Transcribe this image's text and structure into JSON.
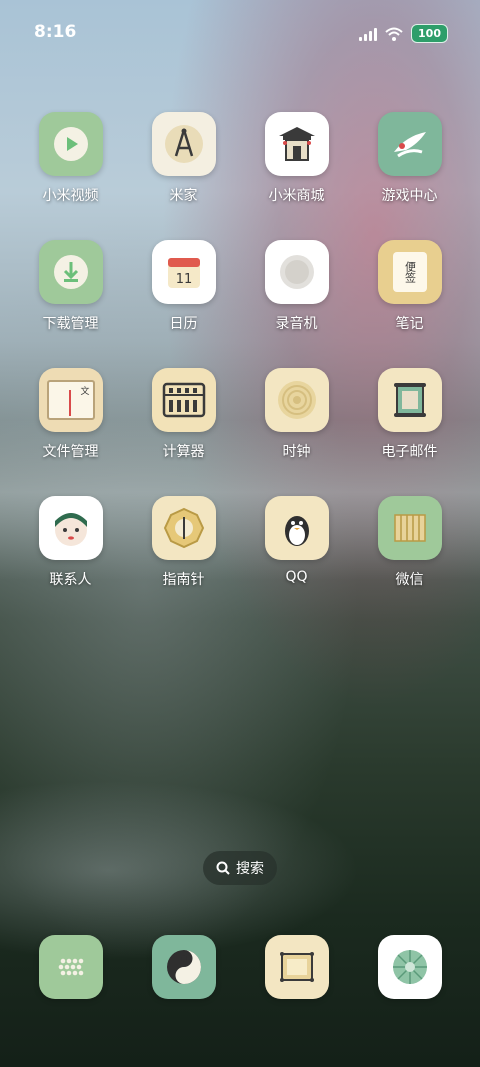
{
  "status_bar": {
    "time": "8:16",
    "battery": "100"
  },
  "apps": [
    {
      "label": "小米视频",
      "icon": "video-play-icon"
    },
    {
      "label": "米家",
      "icon": "compass-tool-icon"
    },
    {
      "label": "小米商城",
      "icon": "pavilion-shop-icon"
    },
    {
      "label": "游戏中心",
      "icon": "crane-bird-icon"
    },
    {
      "label": "下载管理",
      "icon": "download-icon"
    },
    {
      "label": "日历",
      "icon": "calendar-icon",
      "calendar_day": "11"
    },
    {
      "label": "录音机",
      "icon": "recorder-icon"
    },
    {
      "label": "笔记",
      "icon": "notes-icon",
      "glyphs": "便签"
    },
    {
      "label": "文件管理",
      "icon": "file-scroll-icon",
      "glyph": "文"
    },
    {
      "label": "计算器",
      "icon": "abacus-icon"
    },
    {
      "label": "时钟",
      "icon": "clock-icon"
    },
    {
      "label": "电子邮件",
      "icon": "scroll-mail-icon"
    },
    {
      "label": "联系人",
      "icon": "opera-face-icon"
    },
    {
      "label": "指南针",
      "icon": "compass-icon"
    },
    {
      "label": "QQ",
      "icon": "penguin-icon"
    },
    {
      "label": "微信",
      "icon": "bamboo-scroll-icon"
    }
  ],
  "search": {
    "label": "搜索"
  },
  "dock": [
    {
      "icon": "dots-phone-icon"
    },
    {
      "icon": "yin-yang-icon"
    },
    {
      "icon": "scroll-frame-icon"
    },
    {
      "icon": "lotus-leaf-icon"
    }
  ]
}
